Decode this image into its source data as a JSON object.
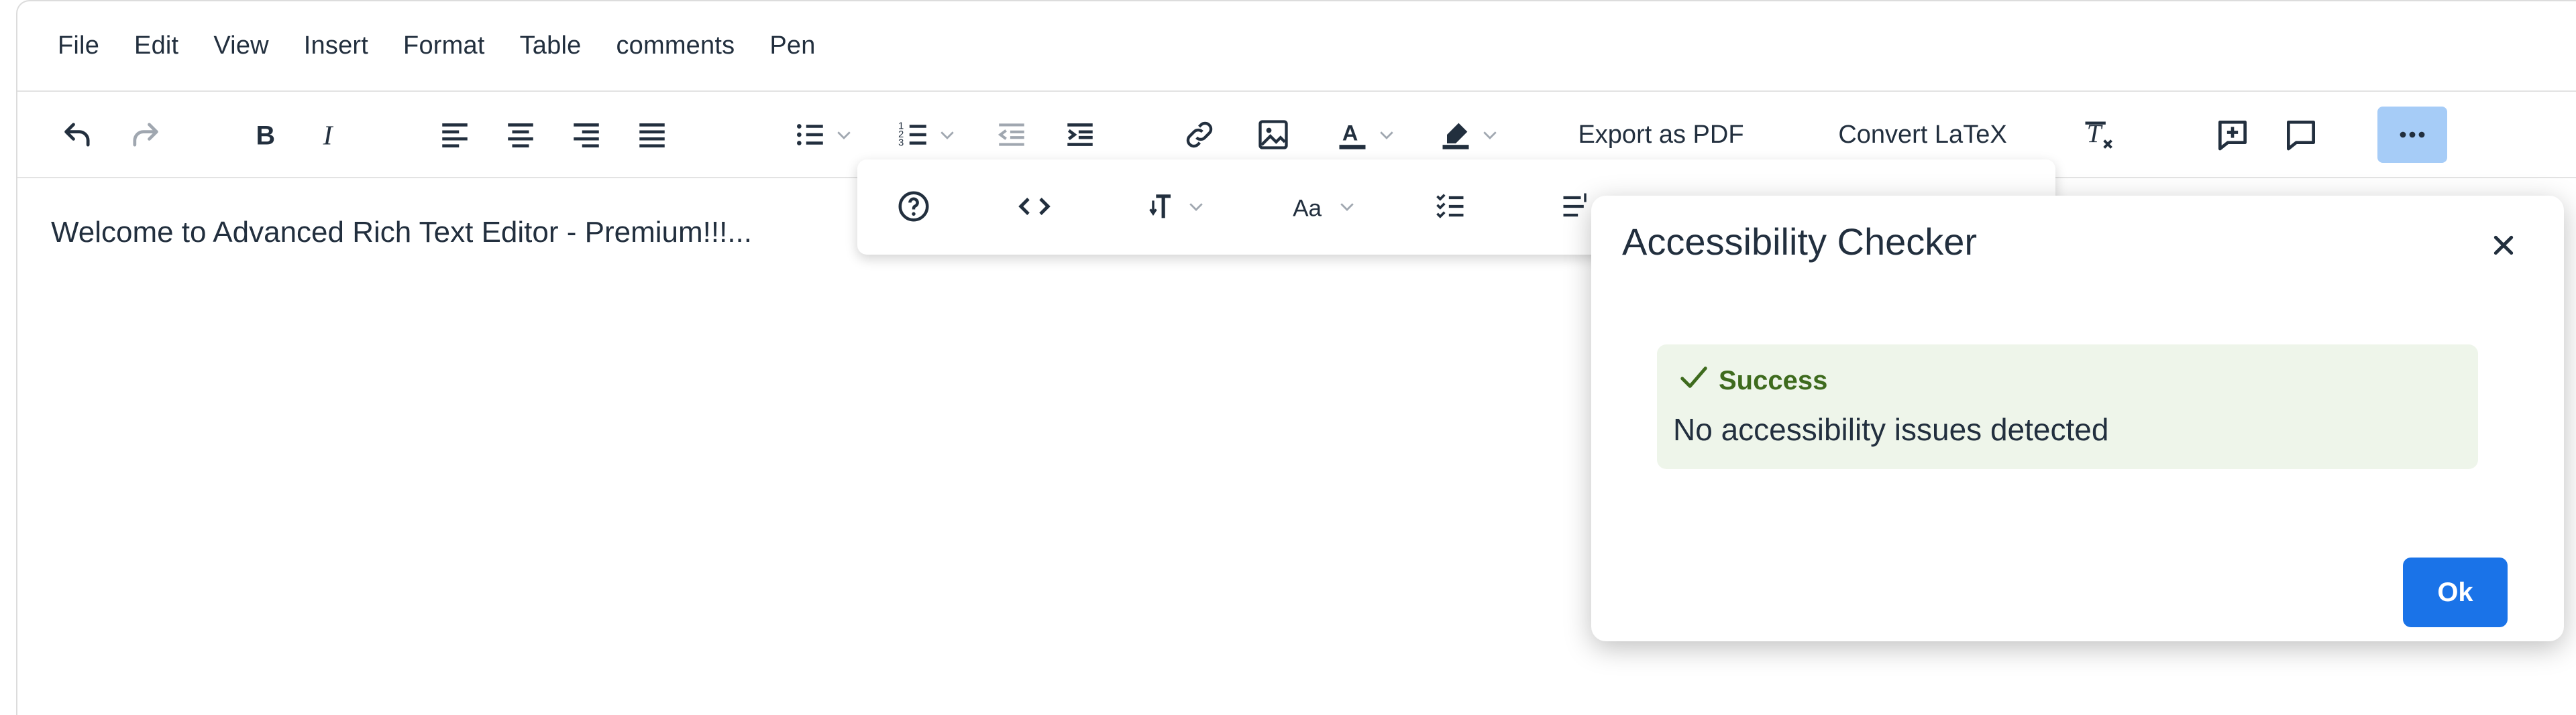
{
  "menubar": {
    "items": [
      "File",
      "Edit",
      "View",
      "Insert",
      "Format",
      "Table",
      "comments",
      "Pen"
    ]
  },
  "toolbar": {
    "export_pdf_label": "Export as PDF",
    "convert_latex_label": "Convert LaTeX",
    "icons": [
      "undo-icon",
      "redo-icon",
      "bold-icon",
      "italic-icon",
      "align-left-icon",
      "align-center-icon",
      "align-right-icon",
      "align-justify-icon",
      "bullet-list-icon",
      "numbered-list-icon",
      "outdent-icon",
      "indent-icon",
      "link-icon",
      "image-icon",
      "text-color-icon",
      "highlight-color-icon",
      "clear-formatting-icon",
      "add-comment-icon",
      "comments-icon",
      "more-icon"
    ],
    "accent_color": "#a6ccf7"
  },
  "overflow_toolbar": {
    "icons": [
      "help-icon",
      "source-code-icon",
      "line-height-icon",
      "font-case-icon",
      "checklist-icon",
      "direction-icon"
    ]
  },
  "editor": {
    "content": "Welcome to Advanced Rich Text Editor - Premium!!!..."
  },
  "dialog": {
    "title": "Accessibility Checker",
    "notice_title": "Success",
    "notice_message": "No accessibility issues detected",
    "ok_label": "Ok",
    "success_color": "#3e6b1e",
    "button_color": "#1a73e8"
  }
}
